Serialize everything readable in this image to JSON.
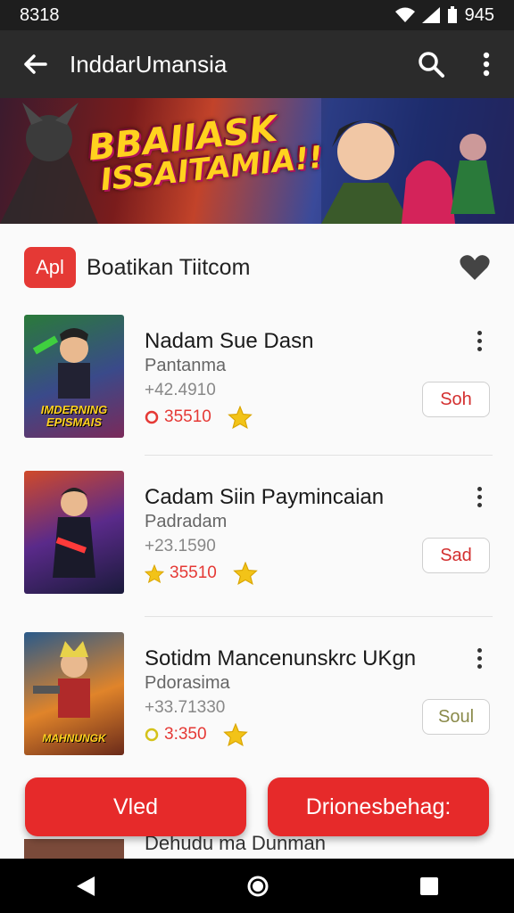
{
  "status": {
    "time": "8318",
    "battery": "945"
  },
  "appbar": {
    "title": "InddarUmansia"
  },
  "banner": {
    "line1": "BBAIIASK",
    "line2": "ISSAITAMIA!!"
  },
  "section": {
    "badge": "Apl",
    "title": "Boatikan Tiitcom"
  },
  "items": [
    {
      "name": "Nadam Sue Dasn",
      "sub": "Pantanma",
      "downloads": "+42.4910",
      "rating": "35510",
      "button": "Soh",
      "rating_icon": "circle",
      "thumb_text": "IMDERNING EPISMAIS"
    },
    {
      "name": "Cadam Siin Paymincaian",
      "sub": "Padradam",
      "downloads": "+23.1590",
      "rating": "35510",
      "button": "Sad",
      "rating_icon": "star",
      "thumb_text": ""
    },
    {
      "name": "Sotidm Mancenunskrc UKgn",
      "sub": "Pdorasima",
      "downloads": "+33.71330",
      "rating": "3:350",
      "button": "Soul",
      "rating_icon": "circle-yellow",
      "thumb_text": "MAHNUNGK"
    }
  ],
  "fab": {
    "left": "Vled",
    "right": "Drionesbehag:"
  },
  "peek": {
    "text": "Dehudu ma Dunman"
  },
  "colors": {
    "accent": "#e62a2a",
    "appbar": "#2b2b2b",
    "star": "#f2c318"
  }
}
